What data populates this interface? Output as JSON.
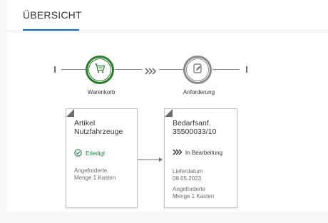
{
  "header": {
    "title": "ÜBERSICHT"
  },
  "process": {
    "steps": [
      {
        "label": "Warenkorb",
        "icon": "cart-icon",
        "state": "completed"
      },
      {
        "label": "Anforderung",
        "icon": "request-edit-icon",
        "state": "in-progress"
      }
    ]
  },
  "cards": [
    {
      "title_line1": "Artikel",
      "title_line2": "Nutzfahrzeuge",
      "status": "Erledigt",
      "status_icon": "checkmark-circle-icon",
      "info_line1": "Angeforderte",
      "info_line2": "Menge 1 Kasten"
    },
    {
      "title_line1": "Bedarfsanf.",
      "title_line2": "35500033/10",
      "status": "In Bearbeitung",
      "status_icon": "chevron-forward-icon",
      "date_label": "Lieferdatum",
      "date_value": "08.05.2023",
      "info_line1": "Angeforderte",
      "info_line2": "Menge 1 Kasten"
    }
  ],
  "colors": {
    "accent": "#0a6ed1",
    "success": "#2b7d2b",
    "neutral": "#8a8a8a"
  }
}
